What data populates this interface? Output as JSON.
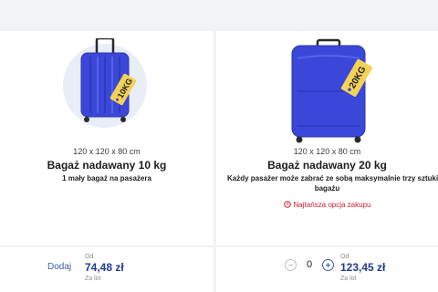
{
  "options": [
    {
      "dimensions": "120 x 120 x 80 cm",
      "title": "Bagaż nadawany 10 kg",
      "description": "1 mały bagaż na pasażera",
      "tag": "10KG",
      "action_label": "Dodaj",
      "price_from": "Od",
      "price": "74,48 zł",
      "price_per": "Za lot"
    },
    {
      "dimensions": "120 x 120 x 80 cm",
      "title": "Bagaż nadawany 20 kg",
      "description": "Każdy pasażer może zabrać ze sobą maksymalnie trzy sztuki",
      "description_cont": "bagażu",
      "badge": "Najtańsza opcja zakupu",
      "tag": "20KG",
      "quantity": "0",
      "price_from": "Od",
      "price": "123,45 zł",
      "price_per": "Za lot"
    }
  ],
  "colors": {
    "suitcase_blue": "#3a47d8",
    "tag_yellow": "#f4d257",
    "price_blue": "#213a8f",
    "badge_red": "#d11c2c"
  }
}
